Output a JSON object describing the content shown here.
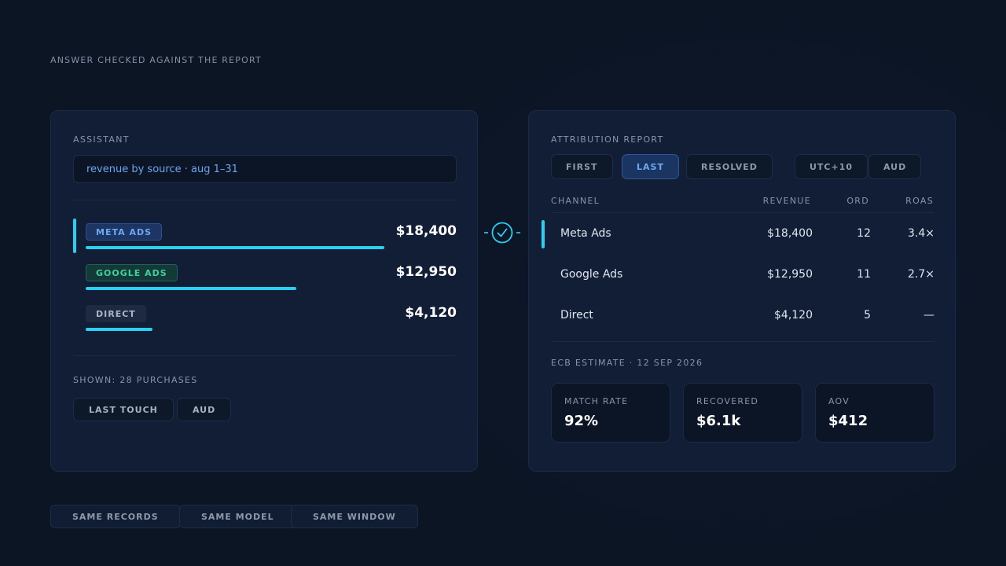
{
  "caption": "ANSWER CHECKED AGAINST THE REPORT",
  "assistant": {
    "label": "ASSISTANT",
    "query": "revenue by source · aug 1–31",
    "sources": [
      {
        "chip": "META ADS",
        "value": "$18,400",
        "share": 1.0
      },
      {
        "chip": "GOOGLE ADS",
        "value": "$12,950",
        "share": 0.705
      },
      {
        "chip": "DIRECT",
        "value": "$4,120",
        "share": 0.224
      }
    ],
    "shown": "SHOWN: 28 PURCHASES",
    "tags": [
      "LAST TOUCH",
      "AUD"
    ]
  },
  "match_icon": "check-circle-icon",
  "report": {
    "label": "ATTRIBUTION REPORT",
    "tabs": [
      "FIRST",
      "LAST",
      "RESOLVED"
    ],
    "active_tab": "LAST",
    "options": [
      "UTC+10",
      "AUD"
    ],
    "columns": [
      "CHANNEL",
      "REVENUE",
      "ORD",
      "ROAS"
    ],
    "rows": [
      {
        "channel": "Meta Ads",
        "revenue": "$18,400",
        "orders": "12",
        "roas": "3.4×"
      },
      {
        "channel": "Google Ads",
        "revenue": "$12,950",
        "orders": "11",
        "roas": "2.7×"
      },
      {
        "channel": "Direct",
        "revenue": "$4,120",
        "orders": "5",
        "roas": "—"
      }
    ],
    "estimate_label": "ECB ESTIMATE · 12 SEP 2026",
    "metrics": [
      {
        "label": "MATCH RATE",
        "value": "92%"
      },
      {
        "label": "RECOVERED",
        "value": "$6.1k"
      },
      {
        "label": "AOV",
        "value": "$412"
      }
    ]
  },
  "footer": [
    "SAME RECORDS",
    "SAME MODEL",
    "SAME WINDOW"
  ],
  "colors": {
    "accent": "#2ad0f0",
    "meta": "#6ea8f2",
    "google": "#3ed1a0",
    "background": "#0c1627",
    "panel": "#111e35"
  }
}
